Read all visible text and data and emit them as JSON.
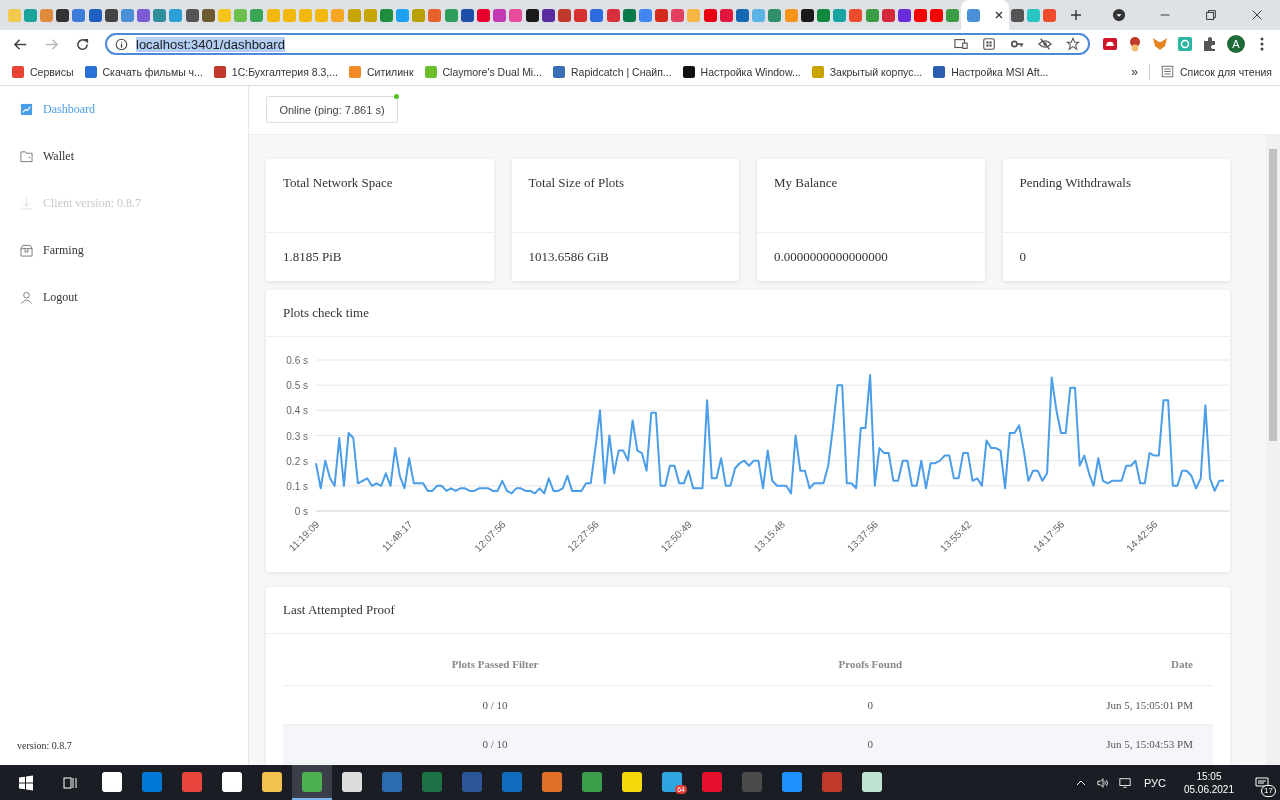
{
  "browser": {
    "tabs": [
      {
        "color": "#f2c94c",
        "selected": false
      },
      {
        "color": "#1ba39c",
        "selected": false
      },
      {
        "color": "#e08a3c",
        "selected": false
      },
      {
        "color": "#333333",
        "selected": false
      },
      {
        "color": "#3b7dd8",
        "selected": false
      },
      {
        "color": "#1f5fbf",
        "selected": false
      },
      {
        "color": "#444444",
        "selected": false
      },
      {
        "color": "#4a8fd6",
        "selected": false
      },
      {
        "color": "#7b5bd6",
        "selected": false
      },
      {
        "color": "#2f8f9d",
        "selected": false
      },
      {
        "color": "#2a9fd6",
        "selected": false
      },
      {
        "color": "#555555",
        "selected": false
      },
      {
        "color": "#6b5b2e",
        "selected": false
      },
      {
        "color": "#f5c518",
        "selected": false
      },
      {
        "color": "#6cbf4b",
        "selected": false
      },
      {
        "color": "#3aa655",
        "selected": false
      },
      {
        "color": "#f0b90b",
        "selected": false
      },
      {
        "color": "#f0b90b",
        "selected": false
      },
      {
        "color": "#f0b90b",
        "selected": false
      },
      {
        "color": "#f0b90b",
        "selected": false
      },
      {
        "color": "#f5a623",
        "selected": false
      },
      {
        "color": "#c8a400",
        "selected": false
      },
      {
        "color": "#c8a400",
        "selected": false
      },
      {
        "color": "#1e8e3e",
        "selected": false
      },
      {
        "color": "#1da1f2",
        "selected": false
      },
      {
        "color": "#b8a000",
        "selected": false
      },
      {
        "color": "#e8632b",
        "selected": false
      },
      {
        "color": "#2e9e5b",
        "selected": false
      },
      {
        "color": "#1d4fa8",
        "selected": false
      },
      {
        "color": "#e8002d",
        "selected": false
      },
      {
        "color": "#c239b3",
        "selected": false
      },
      {
        "color": "#e84b9c",
        "selected": false
      },
      {
        "color": "#1a1a1a",
        "selected": false
      },
      {
        "color": "#5a2ca0",
        "selected": false
      },
      {
        "color": "#c0392b",
        "selected": false
      },
      {
        "color": "#d63031",
        "selected": false
      },
      {
        "color": "#2d6cdf",
        "selected": false
      },
      {
        "color": "#d92e3c",
        "selected": false
      },
      {
        "color": "#0a7a4a",
        "selected": false
      },
      {
        "color": "#4285f4",
        "selected": false
      },
      {
        "color": "#d52b1e",
        "selected": false
      },
      {
        "color": "#e4405f",
        "selected": false
      },
      {
        "color": "#f5b642",
        "selected": false
      },
      {
        "color": "#e60012",
        "selected": false
      },
      {
        "color": "#e3173e",
        "selected": false
      },
      {
        "color": "#1668b2",
        "selected": false
      },
      {
        "color": "#5bb4e5",
        "selected": false
      },
      {
        "color": "#2f8f6a",
        "selected": false
      },
      {
        "color": "#f7931a",
        "selected": false
      },
      {
        "color": "#1a1a1a",
        "selected": false
      },
      {
        "color": "#0f8a3c",
        "selected": false
      },
      {
        "color": "#1aa3a3",
        "selected": false
      },
      {
        "color": "#ee4d2d",
        "selected": false
      },
      {
        "color": "#3a9d46",
        "selected": false
      },
      {
        "color": "#d6283c",
        "selected": false
      },
      {
        "color": "#6c2bd9",
        "selected": false
      },
      {
        "color": "#ff0000",
        "selected": false
      },
      {
        "color": "#ff0000",
        "selected": false
      },
      {
        "color": "#3a9d46",
        "selected": false
      },
      {
        "color": "#4a90d9",
        "selected": true
      },
      {
        "color": "#555555",
        "selected": false
      },
      {
        "color": "#27c4c4",
        "selected": false
      },
      {
        "color": "#ee4d2d",
        "selected": false
      }
    ],
    "address": "localhost:3401/dashboard",
    "profile_initial": "A",
    "bookmarks": [
      {
        "label": "Сервисы",
        "color": "#ea4335"
      },
      {
        "label": "Скачать фильмы ч...",
        "color": "#2a6fd6"
      },
      {
        "label": "1С:Бухгалтерия 8.3,...",
        "color": "#c0392b"
      },
      {
        "label": "Ситилинк",
        "color": "#f08a24"
      },
      {
        "label": "Claymore's Dual Mi...",
        "color": "#6cbf2b"
      },
      {
        "label": "Rapidcatch | Снайп...",
        "color": "#3b6fb6"
      },
      {
        "label": "Настройка Window...",
        "color": "#111111"
      },
      {
        "label": "Закрытый корпус...",
        "color": "#c8a400"
      },
      {
        "label": "Настройка MSI Aft...",
        "color": "#2a5db0"
      }
    ],
    "bookmarks_more": "»",
    "reading_list": "Список для чтения"
  },
  "sidebar": {
    "items": [
      {
        "label": "Dashboard",
        "kind": "chart",
        "selected": true,
        "disabled": false
      },
      {
        "label": "Wallet",
        "kind": "wallet",
        "selected": false,
        "disabled": false
      },
      {
        "label": "Client version: 0.8.7",
        "kind": "download",
        "selected": false,
        "disabled": true
      },
      {
        "label": "Farming",
        "kind": "box",
        "selected": false,
        "disabled": false
      },
      {
        "label": "Logout",
        "kind": "user",
        "selected": false,
        "disabled": false
      }
    ],
    "version": "version: 0.8.7"
  },
  "main": {
    "status": {
      "label": "Online (ping: 7.861 s)",
      "online": true
    },
    "stats": [
      {
        "title": "Total Network Space",
        "value": "1.8185 PiB"
      },
      {
        "title": "Total Size of Plots",
        "value": "1013.6586 GiB"
      },
      {
        "title": "My Balance",
        "value": "0.0000000000000000"
      },
      {
        "title": "Pending Withdrawals",
        "value": "0"
      }
    ],
    "chart": {
      "title": "Plots check time",
      "chart_data": {
        "type": "line",
        "grid": true,
        "color": "#4a9de8",
        "categories": [
          "11:19:09",
          null,
          null,
          null,
          null,
          null,
          null,
          null,
          null,
          null,
          null,
          null,
          null,
          null,
          null,
          null,
          null,
          null,
          null,
          null,
          "11:48:17",
          null,
          null,
          null,
          null,
          null,
          null,
          null,
          null,
          null,
          null,
          null,
          null,
          null,
          null,
          null,
          null,
          null,
          null,
          null,
          "12:07:56",
          null,
          null,
          null,
          null,
          null,
          null,
          null,
          null,
          null,
          null,
          null,
          null,
          null,
          null,
          null,
          null,
          null,
          null,
          null,
          "12:27:56",
          null,
          null,
          null,
          null,
          null,
          null,
          null,
          null,
          null,
          null,
          null,
          null,
          null,
          null,
          null,
          null,
          null,
          null,
          null,
          "12:50:49",
          null,
          null,
          null,
          null,
          null,
          null,
          null,
          null,
          null,
          null,
          null,
          null,
          null,
          null,
          null,
          null,
          null,
          null,
          null,
          "13:15:48",
          null,
          null,
          null,
          null,
          null,
          null,
          null,
          null,
          null,
          null,
          null,
          null,
          null,
          null,
          null,
          null,
          null,
          null,
          null,
          "13:37:56",
          null,
          null,
          null,
          null,
          null,
          null,
          null,
          null,
          null,
          null,
          null,
          null,
          null,
          null,
          null,
          null,
          null,
          null,
          null,
          "13:55:42",
          null,
          null,
          null,
          null,
          null,
          null,
          null,
          null,
          null,
          null,
          null,
          null,
          null,
          null,
          null,
          null,
          null,
          null,
          null,
          "14:17:56",
          null,
          null,
          null,
          null,
          null,
          null,
          null,
          null,
          null,
          null,
          null,
          null,
          null,
          null,
          null,
          null,
          null,
          null,
          null,
          "14:42:56",
          null,
          null,
          null,
          null,
          null,
          null,
          null,
          null,
          null,
          null,
          null,
          null,
          null,
          null,
          null
        ],
        "values": [
          0.19,
          0.09,
          0.2,
          0.13,
          0.1,
          0.29,
          0.1,
          0.31,
          0.29,
          0.11,
          0.12,
          0.13,
          0.1,
          0.11,
          0.1,
          0.15,
          0.1,
          0.25,
          0.14,
          0.09,
          0.21,
          0.11,
          0.11,
          0.11,
          0.08,
          0.08,
          0.1,
          0.1,
          0.08,
          0.09,
          0.08,
          0.09,
          0.09,
          0.08,
          0.08,
          0.09,
          0.09,
          0.09,
          0.08,
          0.08,
          0.12,
          0.08,
          0.07,
          0.09,
          0.09,
          0.08,
          0.08,
          0.07,
          0.09,
          0.07,
          0.13,
          0.08,
          0.08,
          0.09,
          0.14,
          0.08,
          0.08,
          0.08,
          0.11,
          0.11,
          0.25,
          0.4,
          0.11,
          0.3,
          0.15,
          0.24,
          0.24,
          0.2,
          0.36,
          0.24,
          0.23,
          0.16,
          0.39,
          0.39,
          0.1,
          0.1,
          0.18,
          0.18,
          0.11,
          0.11,
          0.16,
          0.09,
          0.09,
          0.09,
          0.44,
          0.13,
          0.13,
          0.21,
          0.1,
          0.1,
          0.17,
          0.19,
          0.2,
          0.18,
          0.2,
          0.2,
          0.09,
          0.24,
          0.12,
          0.1,
          0.1,
          0.1,
          0.07,
          0.3,
          0.16,
          0.16,
          0.09,
          0.11,
          0.11,
          0.11,
          0.18,
          0.33,
          0.5,
          0.5,
          0.11,
          0.11,
          0.09,
          0.33,
          0.33,
          0.54,
          0.1,
          0.25,
          0.23,
          0.23,
          0.12,
          0.12,
          0.2,
          0.2,
          0.1,
          0.1,
          0.2,
          0.09,
          0.19,
          0.19,
          0.2,
          0.22,
          0.22,
          0.13,
          0.13,
          0.23,
          0.23,
          0.12,
          0.13,
          0.1,
          0.28,
          0.25,
          0.25,
          0.24,
          0.09,
          0.31,
          0.31,
          0.34,
          0.24,
          0.12,
          0.16,
          0.16,
          0.12,
          0.15,
          0.53,
          0.4,
          0.31,
          0.31,
          0.49,
          0.49,
          0.18,
          0.22,
          0.15,
          0.1,
          0.21,
          0.12,
          0.11,
          0.12,
          0.12,
          0.12,
          0.18,
          0.18,
          0.2,
          0.11,
          0.11,
          0.23,
          0.22,
          0.22,
          0.44,
          0.44,
          0.1,
          0.1,
          0.16,
          0.16,
          0.14,
          0.09,
          0.13,
          0.42,
          0.13,
          0.08,
          0.12,
          0.12
        ],
        "ylim": [
          0,
          0.6
        ],
        "yticks": [
          {
            "value": 0,
            "label": "0 s"
          },
          {
            "value": 0.1,
            "label": "0.1 s"
          },
          {
            "value": 0.2,
            "label": "0.2 s"
          },
          {
            "value": 0.3,
            "label": "0.3 s"
          },
          {
            "value": 0.4,
            "label": "0.4 s"
          },
          {
            "value": 0.5,
            "label": "0.5 s"
          },
          {
            "value": 0.6,
            "label": "0.6 s"
          }
        ]
      }
    },
    "proofs": {
      "title": "Last Attempted Proof",
      "columns": [
        "Plots Passed Filter",
        "Proofs Found",
        "Date"
      ],
      "rows": [
        [
          "0 / 10",
          "0",
          "Jun 5, 15:05:01 PM"
        ],
        [
          "0 / 10",
          "0",
          "Jun 5, 15:04:53 PM"
        ]
      ]
    }
  },
  "taskbar": {
    "apps": [
      {
        "color": "#ffffff",
        "selected": false
      },
      {
        "color": "#0078d7",
        "selected": false
      },
      {
        "color": "#e8453c",
        "selected": false
      },
      {
        "color": "#ffffff",
        "selected": false
      },
      {
        "color": "#f2c14e",
        "selected": false
      },
      {
        "color": "#4caf50",
        "selected": true
      },
      {
        "color": "#dddddd",
        "selected": false
      },
      {
        "color": "#2b6cb0",
        "selected": false
      },
      {
        "color": "#1d7245",
        "selected": false
      },
      {
        "color": "#2b579a",
        "selected": false
      },
      {
        "color": "#0f6cbd",
        "selected": false
      },
      {
        "color": "#e0702a",
        "selected": false
      },
      {
        "color": "#3c9d4a",
        "selected": false
      },
      {
        "color": "#f5d90a",
        "selected": false
      },
      {
        "color": "#2ca5e0",
        "selected": false,
        "badge": "64"
      },
      {
        "color": "#e8112d",
        "selected": false
      },
      {
        "color": "#4a4a4a",
        "selected": false
      },
      {
        "color": "#1e90ff",
        "selected": false
      },
      {
        "color": "#c0392b",
        "selected": false
      },
      {
        "color": "#bfe3d0",
        "selected": false
      }
    ],
    "language": "РУС",
    "time": "15:05",
    "date": "05.06.2021",
    "notifications": "17"
  }
}
